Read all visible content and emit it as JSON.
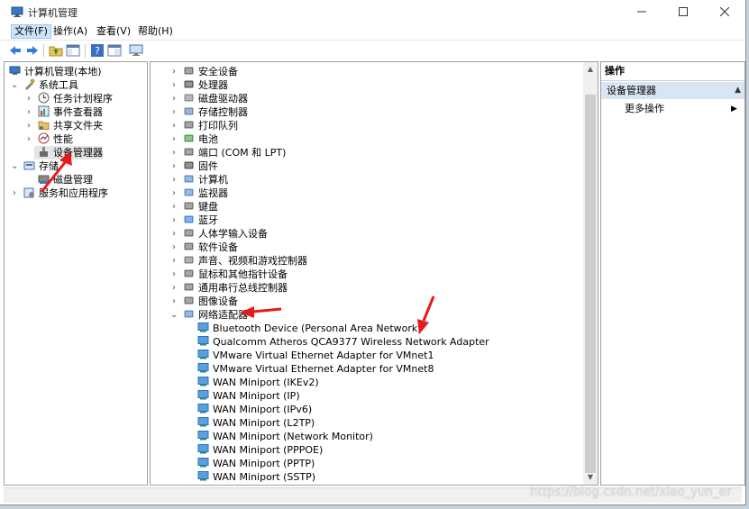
{
  "window": {
    "title": "计算机管理"
  },
  "menu": [
    "文件(F)",
    "操作(A)",
    "查看(V)",
    "帮助(H)"
  ],
  "toolbar": [
    "back-icon",
    "forward-icon",
    "folder-up-icon",
    "show-hide-tree-icon",
    "help-icon",
    "properties-icon",
    "monitor-icon"
  ],
  "tree": [
    {
      "label": "计算机管理(本地)",
      "level": 0
    },
    {
      "label": "系统工具",
      "level": 1
    },
    {
      "label": "任务计划程序",
      "level": 2
    },
    {
      "label": "事件查看器",
      "level": 2
    },
    {
      "label": "共享文件夹",
      "level": 2
    },
    {
      "label": "性能",
      "level": 2
    },
    {
      "label": "设备管理器",
      "level": 2,
      "selected": true
    },
    {
      "label": "存储",
      "level": 1
    },
    {
      "label": "磁盘管理",
      "level": 2
    },
    {
      "label": "服务和应用程序",
      "level": 1
    }
  ],
  "devices": {
    "categories": [
      "安全设备",
      "处理器",
      "磁盘驱动器",
      "存储控制器",
      "打印队列",
      "电池",
      "端口 (COM 和 LPT)",
      "固件",
      "计算机",
      "监视器",
      "键盘",
      "蓝牙",
      "人体学输入设备",
      "软件设备",
      "声音、视频和游戏控制器",
      "鼠标和其他指针设备",
      "通用串行总线控制器",
      "图像设备",
      "网络适配器"
    ],
    "network_adapters": [
      "Bluetooth Device (Personal Area Network)",
      "Qualcomm Atheros QCA9377 Wireless Network Adapter",
      "VMware Virtual Ethernet Adapter for VMnet1",
      "VMware Virtual Ethernet Adapter for VMnet8",
      "WAN Miniport (IKEv2)",
      "WAN Miniport (IP)",
      "WAN Miniport (IPv6)",
      "WAN Miniport (L2TP)",
      "WAN Miniport (Network Monitor)",
      "WAN Miniport (PPPOE)",
      "WAN Miniport (PPTP)",
      "WAN Miniport (SSTP)"
    ]
  },
  "actions": {
    "header": "操作",
    "section": "设备管理器",
    "more": "更多操作"
  },
  "watermark": "https://blog.csdn.net/xiao_yun_er",
  "colors": {
    "selection": "#e5e5e5",
    "action_section": "#d8e6f3",
    "annotation_arrow": "#e8191b"
  }
}
